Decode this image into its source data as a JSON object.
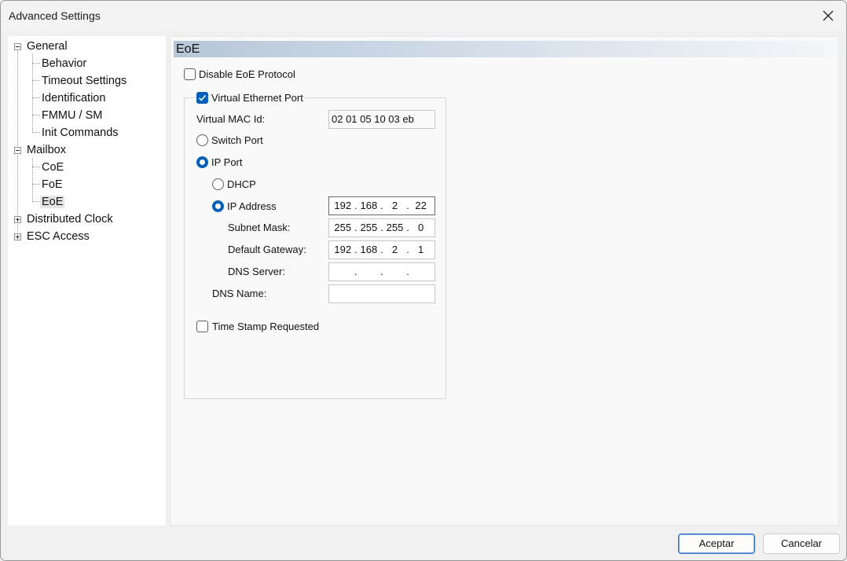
{
  "window": {
    "title": "Advanced Settings"
  },
  "tree": {
    "general": "General",
    "behavior": "Behavior",
    "timeout_settings": "Timeout Settings",
    "identification": "Identification",
    "fmmu_sm": "FMMU / SM",
    "init_commands": "Init Commands",
    "mailbox": "Mailbox",
    "coe": "CoE",
    "foe": "FoE",
    "eoe": "EoE",
    "distributed_clock": "Distributed Clock",
    "esc_access": "ESC Access",
    "selected": "EoE"
  },
  "eoe": {
    "header": "EoE",
    "disable_eoe_label": "Disable EoE Protocol",
    "disable_eoe_checked": false,
    "virtual_ethernet_port_label": "Virtual Ethernet Port",
    "virtual_ethernet_port_checked": true,
    "virtual_mac_label": "Virtual MAC Id:",
    "virtual_mac_value": "02 01 05 10 03 eb",
    "switch_port_label": "Switch Port",
    "ip_port_label": "IP Port",
    "port_mode_selected": "IP Port",
    "dhcp_label": "DHCP",
    "ip_address_label": "IP Address",
    "ip_mode_selected": "IP Address",
    "ip_address": [
      "192",
      "168",
      "2",
      "22"
    ],
    "subnet_mask_label": "Subnet Mask:",
    "subnet_mask": [
      "255",
      "255",
      "255",
      "0"
    ],
    "default_gateway_label": "Default Gateway:",
    "default_gateway": [
      "192",
      "168",
      "2",
      "1"
    ],
    "dns_server_label": "DNS Server:",
    "dns_server": [
      "",
      "",
      "",
      ""
    ],
    "dns_name_label": "DNS Name:",
    "dns_name_value": "",
    "time_stamp_label": "Time Stamp Requested",
    "time_stamp_checked": false
  },
  "buttons": {
    "accept": "Aceptar",
    "cancel": "Cancelar"
  },
  "colors": {
    "accent": "#005fb8",
    "header_gradient_start": "#b6c6d8"
  }
}
